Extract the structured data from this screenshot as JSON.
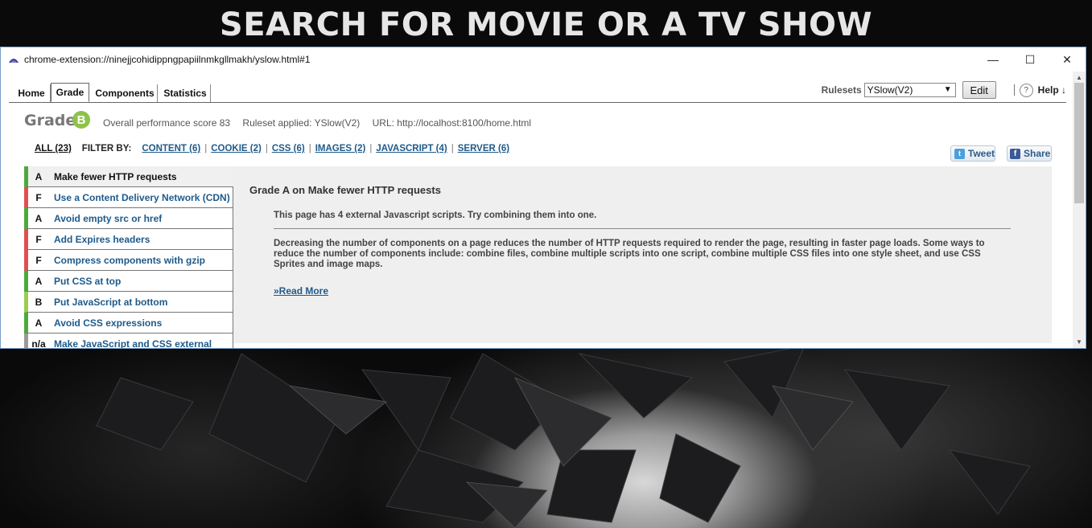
{
  "page": {
    "heading": "SEARCH FOR MOVIE OR A TV SHOW"
  },
  "window": {
    "title": "chrome-extension://ninejjcohidippngpapiilnmkgllmakh/yslow.html#1",
    "icon": "yslow-icon",
    "controls": {
      "minimize": "—",
      "maximize": "☐",
      "close": "✕"
    }
  },
  "tabs": [
    {
      "label": "Home",
      "active": false
    },
    {
      "label": "Grade",
      "active": true
    },
    {
      "label": "Components",
      "active": false
    },
    {
      "label": "Statistics",
      "active": false
    }
  ],
  "toolbar": {
    "rulesets_label": "Rulesets",
    "ruleset_selected": "YSlow(V2)",
    "edit_label": "Edit",
    "help_icon": "?",
    "help_label": "Help ↓"
  },
  "grade": {
    "title": "Grade",
    "letter": "B",
    "letter_color": "#8fc24a",
    "score_text": "Overall performance score 83",
    "ruleset_text": "Ruleset applied: YSlow(V2)",
    "url_text": "URL: http://localhost:8100/home.html"
  },
  "filters": {
    "all": "ALL (23)",
    "label": "FILTER BY:",
    "items": [
      "CONTENT (6)",
      "COOKIE (2)",
      "CSS (6)",
      "IMAGES (2)",
      "JAVASCRIPT (4)",
      "SERVER (6)"
    ]
  },
  "social": {
    "tweet": "Tweet",
    "share": "Share"
  },
  "rules": [
    {
      "grade": "A",
      "name": "Make fewer HTTP requests",
      "color": "#4caa3d",
      "selected": true
    },
    {
      "grade": "F",
      "name": "Use a Content Delivery Network (CDN)",
      "color": "#e05050",
      "selected": false
    },
    {
      "grade": "A",
      "name": "Avoid empty src or href",
      "color": "#4caa3d",
      "selected": false
    },
    {
      "grade": "F",
      "name": "Add Expires headers",
      "color": "#e05050",
      "selected": false
    },
    {
      "grade": "F",
      "name": "Compress components with gzip",
      "color": "#e05050",
      "selected": false
    },
    {
      "grade": "A",
      "name": "Put CSS at top",
      "color": "#4caa3d",
      "selected": false
    },
    {
      "grade": "B",
      "name": "Put JavaScript at bottom",
      "color": "#9acd4f",
      "selected": false
    },
    {
      "grade": "A",
      "name": "Avoid CSS expressions",
      "color": "#4caa3d",
      "selected": false
    },
    {
      "grade": "n/a",
      "name": "Make JavaScript and CSS external",
      "color": "#999999",
      "selected": false
    }
  ],
  "detail": {
    "heading": "Grade A on Make fewer HTTP requests",
    "summary": "This page has 4 external Javascript scripts. Try combining them into one.",
    "description": "Decreasing the number of components on a page reduces the number of HTTP requests required to render the page, resulting in faster page loads. Some ways to reduce the number of components include: combine files, combine multiple scripts into one script, combine multiple CSS files into one style sheet, and use CSS Sprites and image maps.",
    "read_more": "»Read More"
  }
}
